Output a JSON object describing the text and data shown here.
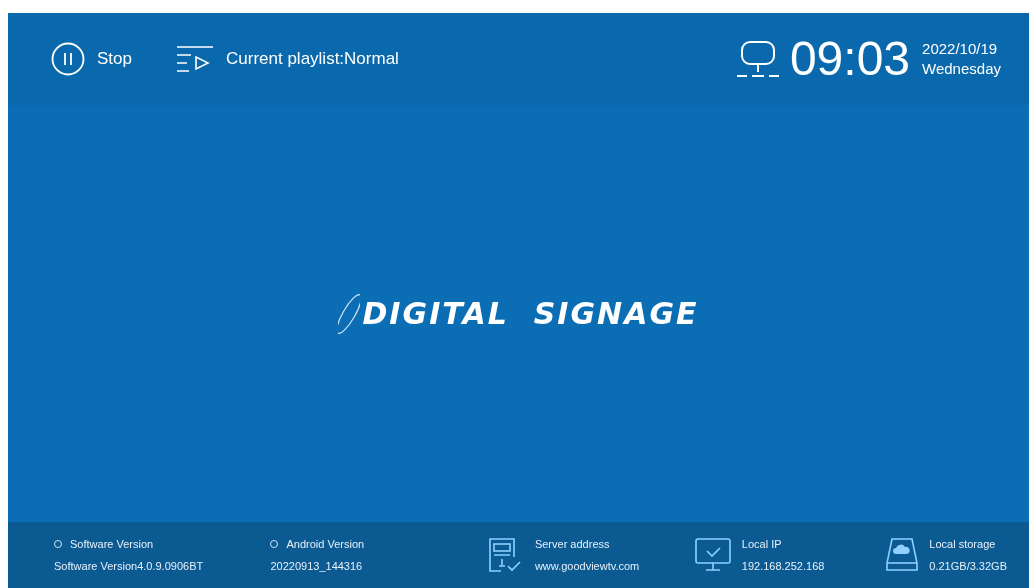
{
  "header": {
    "stop_button": "Stop",
    "playlist": "Current playlist:Normal",
    "time": "09:03",
    "date": "2022/10/19",
    "weekday": "Wednesday"
  },
  "logo": "DIGITAL  SIGNAGE",
  "footer": [
    {
      "kind": "dot",
      "label": "Software Version",
      "value": "Software Version4.0.9.0906BT"
    },
    {
      "kind": "dot",
      "label": "Android Version",
      "value": "20220913_144316"
    },
    {
      "kind": "server",
      "label": "Server address",
      "value": "www.goodviewtv.com"
    },
    {
      "kind": "network",
      "label": "Local IP",
      "value": "192.168.252.168"
    },
    {
      "kind": "storage",
      "label": "Local storage",
      "value": "0.21GB/3.32GB"
    }
  ]
}
